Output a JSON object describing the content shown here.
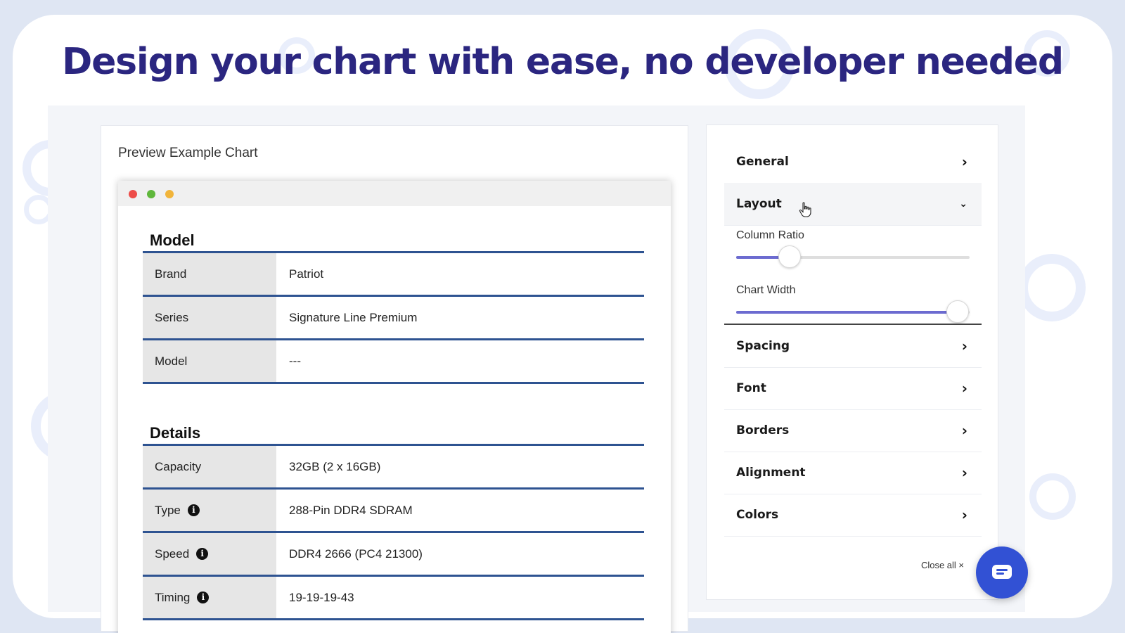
{
  "headline": "Design your chart with ease, no developer needed",
  "preview": {
    "title": "Preview Example Chart",
    "window_dots": [
      "#ed4c48",
      "#5fb73b",
      "#f1b43a"
    ],
    "sections": [
      {
        "title": "Model",
        "rows": [
          {
            "key": "Brand",
            "value": "Patriot",
            "info": false
          },
          {
            "key": "Series",
            "value": "Signature Line Premium",
            "info": false
          },
          {
            "key": "Model",
            "value": "---",
            "info": false
          }
        ]
      },
      {
        "title": "Details",
        "rows": [
          {
            "key": "Capacity",
            "value": "32GB (2 x 16GB)",
            "info": false
          },
          {
            "key": "Type",
            "value": "288-Pin DDR4 SDRAM",
            "info": true
          },
          {
            "key": "Speed",
            "value": "DDR4 2666 (PC4 21300)",
            "info": true
          },
          {
            "key": "Timing",
            "value": "19-19-19-43",
            "info": true
          }
        ]
      }
    ]
  },
  "settings": {
    "general": "General",
    "layout": "Layout",
    "column_ratio_label": "Column Ratio",
    "column_ratio_value": 0.23,
    "chart_width_label": "Chart Width",
    "chart_width_value": 0.95,
    "spacing": "Spacing",
    "font": "Font",
    "borders": "Borders",
    "alignment": "Alignment",
    "colors": "Colors",
    "close_all": "Close all ×",
    "chevron_right": "›",
    "chevron_open": "⌄"
  },
  "colors": {
    "headline": "#2b2680",
    "table_rule": "#2e5391",
    "slider_fill": "#6c6bd0",
    "chat_button": "#3251d4"
  },
  "icons": {
    "info": "info-icon",
    "chevron": "chevron-right-icon",
    "cursor": "hand-pointer-icon",
    "chat": "chat-bubble-icon"
  }
}
